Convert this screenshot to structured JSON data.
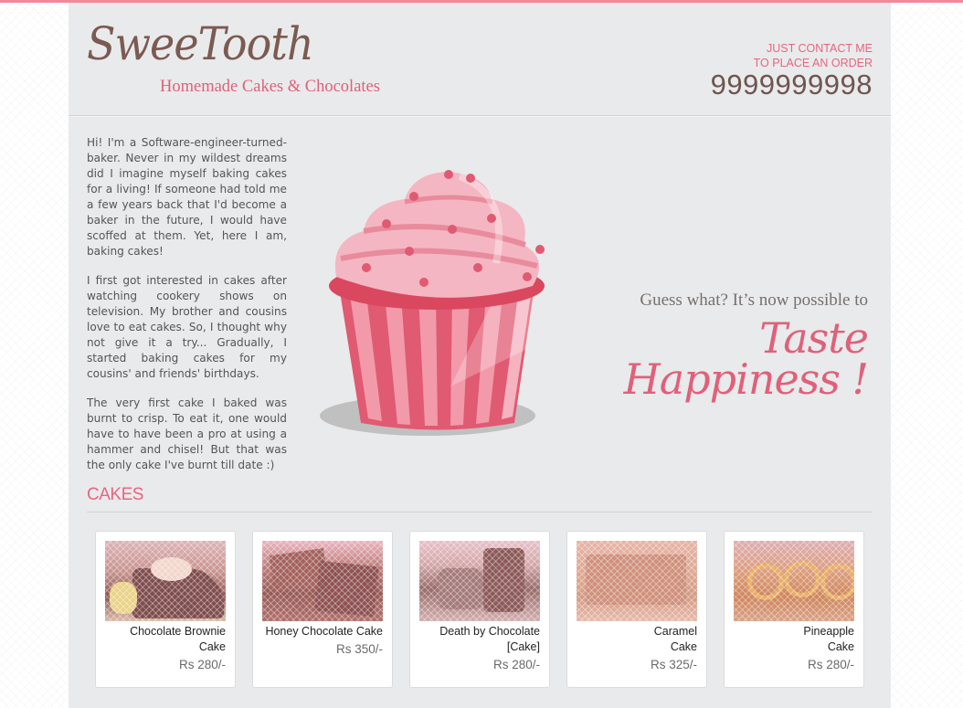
{
  "brand": {
    "logo": "SweeTooth",
    "tagline": "Homemade Cakes & Chocolates"
  },
  "contact": {
    "line1": "JUST CONTACT ME",
    "line2": "TO PLACE AN ORDER",
    "phone": "9999999998"
  },
  "intro": {
    "p1": "Hi! I'm a Software-engineer-turned-baker. Never in my wildest dreams did I imagine myself baking cakes for a living! If someone had told me a few years back that I'd become a baker in the future, I would have scoffed at them. Yet, here I am, baking cakes!",
    "p2": "I first got interested in cakes after watching cookery shows on television. My brother and cousins love to eat cakes. So, I thought why not give it a try... Gradually, I started baking cakes for my cousins' and friends' birthdays.",
    "p3": "The very first cake I baked was burnt to crisp. To eat it, one would have to have been a pro at using a hammer and chisel! But that was the only cake I've burnt till date :)"
  },
  "hero": {
    "guess": "Guess what? It’s now possible to",
    "taste_line1": "Taste",
    "taste_line2": "Happiness !"
  },
  "cakes": {
    "title": "CAKES",
    "items": [
      {
        "name": "Chocolate Brownie Cake",
        "price": "Rs 280/-"
      },
      {
        "name": "Honey Chocolate Cake",
        "price": "Rs 350/-"
      },
      {
        "name": "Death by Chocolate [Cake]",
        "price": "Rs 280/-"
      },
      {
        "name": "Caramel Cake",
        "price": "Rs 325/-"
      },
      {
        "name": "Pineapple Cake",
        "price": "Rs 280/-"
      }
    ]
  },
  "colors": {
    "accent": "#e8657f",
    "brown": "#6f5550",
    "panel": "#e9eaeb"
  }
}
